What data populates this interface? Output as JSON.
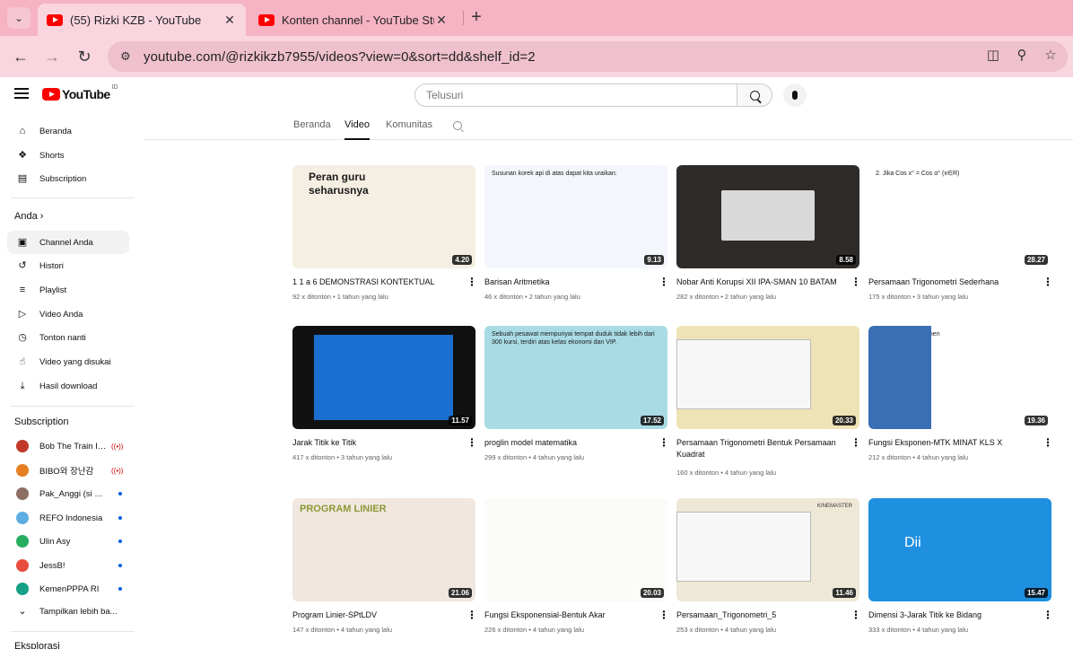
{
  "browser": {
    "tabs": [
      {
        "title": "(55) Rizki KZB - YouTube",
        "active": true
      },
      {
        "title": "Konten channel - YouTube Stud",
        "active": false
      }
    ],
    "url": "youtube.com/@rizkikzb7955/videos?view=0&sort=dd&shelf_id=2"
  },
  "masthead": {
    "logo_text": "YouTube",
    "logo_region": "ID",
    "search_placeholder": "Telusuri"
  },
  "sidebar": {
    "main": [
      {
        "label": "Beranda",
        "icon": "home-icon"
      },
      {
        "label": "Shorts",
        "icon": "shorts-icon"
      },
      {
        "label": "Subscription",
        "icon": "subscriptions-icon"
      }
    ],
    "anda_heading": "Anda",
    "anda": [
      {
        "label": "Channel Anda",
        "icon": "channel-icon"
      },
      {
        "label": "Histori",
        "icon": "history-icon"
      },
      {
        "label": "Playlist",
        "icon": "playlist-icon"
      },
      {
        "label": "Video Anda",
        "icon": "video-icon"
      },
      {
        "label": "Tonton nanti",
        "icon": "clock-icon"
      },
      {
        "label": "Video yang disukai",
        "icon": "like-icon"
      },
      {
        "label": "Hasil download",
        "icon": "download-icon"
      }
    ],
    "subs_heading": "Subscription",
    "subscriptions": [
      {
        "name": "Bob The Train In...",
        "color": "#c0392b",
        "status": "live"
      },
      {
        "name": "BIBO와 장난감",
        "color": "#e67e22",
        "status": "live"
      },
      {
        "name": "Pak_Anggi (si Gu...",
        "color": "#8d6e63",
        "status": "new"
      },
      {
        "name": "REFO Indonesia",
        "color": "#5dade2",
        "status": "new"
      },
      {
        "name": "Ulin Asy",
        "color": "#27ae60",
        "status": "new"
      },
      {
        "name": "JessB!",
        "color": "#e74c3c",
        "status": "new"
      },
      {
        "name": "KemenPPPA RI",
        "color": "#16a085",
        "status": "new"
      }
    ],
    "show_more": "Tampilkan lebih ba...",
    "explore_heading": "Eksplorasi"
  },
  "channel_tabs": [
    "Beranda",
    "Video",
    "Komunitas"
  ],
  "videos": [
    {
      "title": "1 1 a 6 DEMONSTRASI KONTEKTUAL",
      "views": "92 x ditonton",
      "age": "1 tahun yang lalu",
      "duration": "4.20",
      "bg": "#f4efe2",
      "thumb_text": "Peran guru seharusnya"
    },
    {
      "title": "Barisan Aritmetika",
      "views": "46 x ditonton",
      "age": "2 tahun yang lalu",
      "duration": "9.13",
      "bg": "#f3f6fb",
      "thumb_text": "Susunan korek api di atas dapat kita uraikan:"
    },
    {
      "title": "Nobar Anti Korupsi XII IPA-SMAN 10 BATAM",
      "views": "282 x ditonton",
      "age": "2 tahun yang lalu",
      "duration": "8.58",
      "bg": "#2e2b29",
      "thumb_text": ""
    },
    {
      "title": "Persamaan Trigonometri Sederhana",
      "views": "175 x ditonton",
      "age": "3 tahun yang lalu",
      "duration": "28.27",
      "bg": "#ffffff",
      "thumb_text": "2. Jika Cos x° = Cos α° (x∈R)"
    },
    {
      "title": "Jarak Titik ke Titik",
      "views": "417 x ditonton",
      "age": "3 tahun yang lalu",
      "duration": "11.57",
      "bg": "#111111",
      "thumb_text": ""
    },
    {
      "title": "proglin model matematika",
      "views": "299 x ditonton",
      "age": "4 tahun yang lalu",
      "duration": "17.52",
      "bg": "#a9dbe4",
      "thumb_text": "Sebuah pesawat mempunyai tempat duduk tidak lebih dari 300 kursi, terdiri atas kelas ekonomi dan VIP."
    },
    {
      "title": "Persamaan Trigonometri Bentuk Persamaan Kuadrat",
      "views": "160 x ditonton",
      "age": "4 tahun yang lalu",
      "duration": "20.33",
      "bg": "#efe3b6",
      "thumb_text": ""
    },
    {
      "title": "Fungsi Eksponen-MTK MINAT KLS X",
      "views": "212 x ditonton",
      "age": "4 tahun yang lalu",
      "duration": "19.36",
      "bg": "#ffffff",
      "thumb_text": "Grafik fungsi eksponen"
    },
    {
      "title": "Program Linier-SPtLDV",
      "views": "147 x ditonton",
      "age": "4 tahun yang lalu",
      "duration": "21.06",
      "bg": "#f1e7df",
      "thumb_text": "PROGRAM LINIER"
    },
    {
      "title": "Fungsi Eksponensial-Bentuk Akar",
      "views": "226 x ditonton",
      "age": "4 tahun yang lalu",
      "duration": "20.03",
      "bg": "#fbfbf7",
      "thumb_text": ""
    },
    {
      "title": "Persamaan_Trigonometri_5",
      "views": "253 x ditonton",
      "age": "4 tahun yang lalu",
      "duration": "11.46",
      "bg": "#eee8d6",
      "thumb_text": "KINEMASTER"
    },
    {
      "title": "Dimensi 3-Jarak Titik ke Bidang",
      "views": "333 x ditonton",
      "age": "4 tahun yang lalu",
      "duration": "15.47",
      "bg": "#1f8fe0",
      "thumb_text": "Dii"
    }
  ]
}
